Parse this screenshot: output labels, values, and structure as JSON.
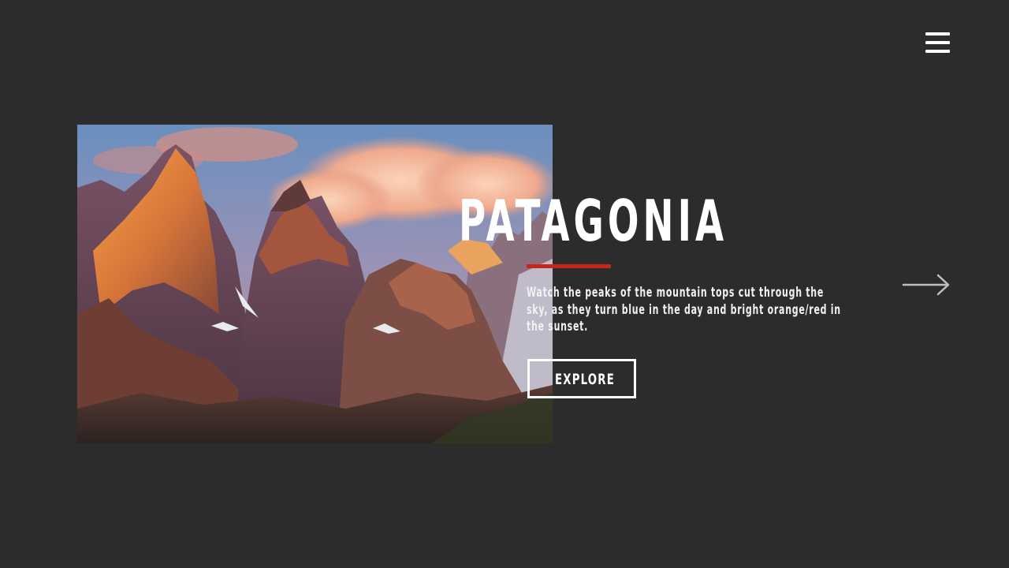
{
  "header": {
    "menu_icon": "hamburger-menu-icon"
  },
  "slide": {
    "title": "PATAGONIA",
    "description": "Watch the peaks of the mountain tops cut through the sky, as they turn blue in the day and bright orange/red in the sunset.",
    "cta_label": "EXPLORE",
    "image_subject": "mountain-peaks-at-sunset",
    "next_icon": "arrow-right-icon"
  },
  "colors": {
    "background": "#2c2c2c",
    "accent": "#c7271b",
    "text": "#ffffff"
  }
}
